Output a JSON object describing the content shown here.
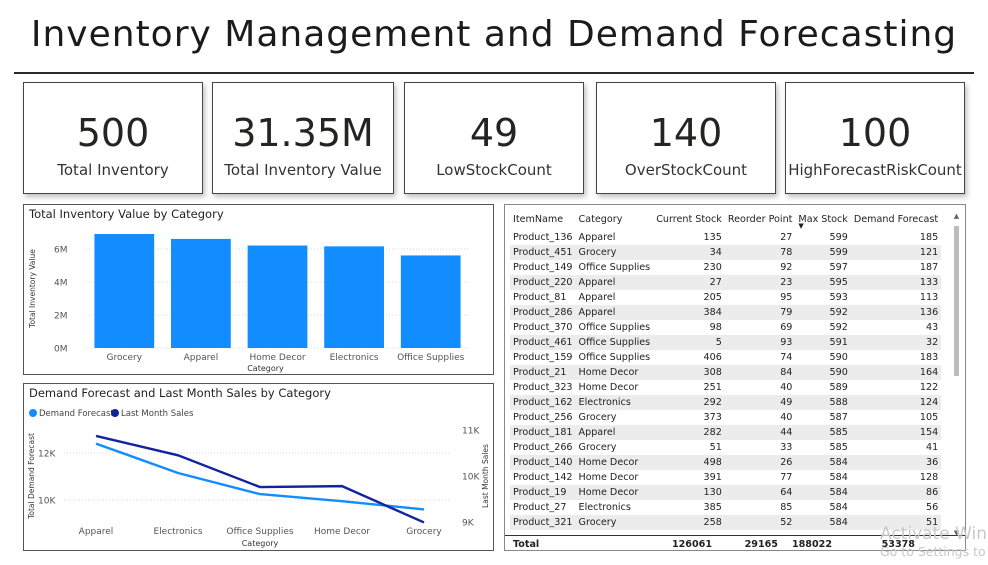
{
  "title": "Inventory Management and Demand Forecasting",
  "kpis": [
    {
      "value": "500",
      "label": "Total Inventory"
    },
    {
      "value": "31.35M",
      "label": "Total Inventory Value"
    },
    {
      "value": "49",
      "label": "LowStockCount"
    },
    {
      "value": "140",
      "label": "OverStockCount"
    },
    {
      "value": "100",
      "label": "HighForecastRiskCount"
    }
  ],
  "bar_chart_title": "Total Inventory Value by Category",
  "line_chart_title": "Demand Forecast and Last Month Sales by Category",
  "table": {
    "headers": [
      "ItemName",
      "Category",
      "Current Stock",
      "Reorder Point",
      "Max Stock",
      "Demand Forecast"
    ],
    "sort_icon": "sort-descending-icon",
    "rows": [
      [
        "Product_136",
        "Apparel",
        "135",
        "27",
        "599",
        "185"
      ],
      [
        "Product_451",
        "Grocery",
        "34",
        "78",
        "599",
        "121"
      ],
      [
        "Product_149",
        "Office Supplies",
        "230",
        "92",
        "597",
        "187"
      ],
      [
        "Product_220",
        "Apparel",
        "27",
        "23",
        "595",
        "133"
      ],
      [
        "Product_81",
        "Apparel",
        "205",
        "95",
        "593",
        "113"
      ],
      [
        "Product_286",
        "Apparel",
        "384",
        "79",
        "592",
        "136"
      ],
      [
        "Product_370",
        "Office Supplies",
        "98",
        "69",
        "592",
        "43"
      ],
      [
        "Product_461",
        "Office Supplies",
        "5",
        "93",
        "591",
        "32"
      ],
      [
        "Product_159",
        "Office Supplies",
        "406",
        "74",
        "590",
        "183"
      ],
      [
        "Product_21",
        "Home Decor",
        "308",
        "84",
        "590",
        "164"
      ],
      [
        "Product_323",
        "Home Decor",
        "251",
        "40",
        "589",
        "122"
      ],
      [
        "Product_162",
        "Electronics",
        "292",
        "49",
        "588",
        "124"
      ],
      [
        "Product_256",
        "Grocery",
        "373",
        "40",
        "587",
        "105"
      ],
      [
        "Product_181",
        "Apparel",
        "282",
        "44",
        "585",
        "154"
      ],
      [
        "Product_266",
        "Grocery",
        "51",
        "33",
        "585",
        "41"
      ],
      [
        "Product_140",
        "Home Decor",
        "498",
        "26",
        "584",
        "36"
      ],
      [
        "Product_142",
        "Home Decor",
        "391",
        "77",
        "584",
        "128"
      ],
      [
        "Product_19",
        "Home Decor",
        "130",
        "64",
        "584",
        "86"
      ],
      [
        "Product_27",
        "Electronics",
        "385",
        "85",
        "584",
        "56"
      ],
      [
        "Product_321",
        "Grocery",
        "258",
        "52",
        "584",
        "51"
      ]
    ],
    "totals": {
      "label": "Total",
      "current_stock": "126061",
      "reorder_point": "29165",
      "max_stock": "188022",
      "demand_forecast": "53378"
    }
  },
  "watermark": {
    "line1": "Activate Windows",
    "line2": "Go to Settings to activate Windows."
  },
  "colors": {
    "bar": "#118dff",
    "demand_forecast": "#118dff",
    "last_month_sales": "#12239e"
  },
  "chart_data": [
    {
      "type": "bar",
      "title": "Total Inventory Value by Category",
      "categories": [
        "Grocery",
        "Apparel",
        "Home Decor",
        "Electronics",
        "Office Supplies"
      ],
      "values": [
        6.9,
        6.6,
        6.2,
        6.15,
        5.6
      ],
      "unit": "M",
      "xlabel": "Category",
      "ylabel": "Total Inventory Value",
      "yticks": [
        "0M",
        "2M",
        "4M",
        "6M"
      ],
      "ylim": [
        0,
        7.2
      ],
      "grid": true
    },
    {
      "type": "line",
      "title": "Demand Forecast and Last Month Sales by Category",
      "categories": [
        "Apparel",
        "Electronics",
        "Office Supplies",
        "Home Decor",
        "Grocery"
      ],
      "xlabel": "Category",
      "ylabel_left": "Total Demand Forecast",
      "ylabel_right": "Last Month Sales",
      "yticks_left": [
        "10K",
        "12K"
      ],
      "yticks_right": [
        "9K",
        "10K",
        "11K"
      ],
      "ylim_left": [
        9000,
        13200
      ],
      "ylim_right": [
        8900,
        11100
      ],
      "legend_position": "top-left",
      "series": [
        {
          "name": "Demand Forecast",
          "axis": "left",
          "values": [
            12400,
            11150,
            10250,
            9950,
            9600
          ]
        },
        {
          "name": "Last Month  Sales",
          "axis": "right",
          "values": [
            10870,
            10450,
            9760,
            9780,
            8990
          ]
        }
      ]
    }
  ]
}
